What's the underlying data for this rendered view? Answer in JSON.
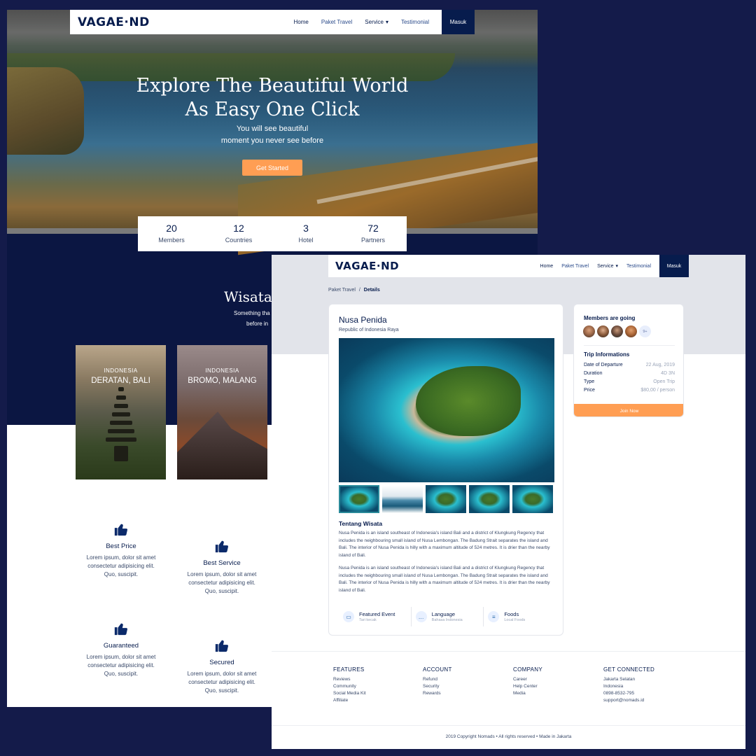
{
  "landing": {
    "logo": "VAGAE·ND",
    "nav": {
      "home": "Home",
      "paket": "Paket Travel",
      "service": "Service",
      "testimonial": "Testimonial",
      "masuk": "Masuk"
    },
    "hero": {
      "title_line1": "Explore The Beautiful World",
      "title_line2": "As Easy One Click",
      "sub_line1": "You will see beautiful",
      "sub_line2": "moment you never see before",
      "cta": "Get Started"
    },
    "stats": [
      {
        "num": "20",
        "label": "Members"
      },
      {
        "num": "12",
        "label": "Countries"
      },
      {
        "num": "3",
        "label": "Hotel"
      },
      {
        "num": "72",
        "label": "Partners"
      }
    ],
    "wisata": {
      "title": "Wisata",
      "sub_line1": "Something tha",
      "sub_line2": "before in"
    },
    "destinations": [
      {
        "country": "INDONESIA",
        "place": "DERATAN, BALI"
      },
      {
        "country": "INDONESIA",
        "place": "BROMO, MALANG"
      }
    ],
    "features": [
      {
        "name": "Best Price",
        "desc1": "Lorem ipsum, dolor sit amet",
        "desc2": "consectetur adipisicing elit.",
        "desc3": "Quo, suscipit."
      },
      {
        "name": "Best Service",
        "desc1": "Lorem ipsum, dolor sit amet",
        "desc2": "consectetur adipisicing elit.",
        "desc3": "Quo, suscipit."
      },
      {
        "name": "Guaranteed",
        "desc1": "Lorem ipsum, dolor sit amet",
        "desc2": "consectetur adipisicing elit.",
        "desc3": "Quo, suscipit."
      },
      {
        "name": "Secured",
        "desc1": "Lorem ipsum, dolor sit amet",
        "desc2": "consectetur adipisicing elit.",
        "desc3": "Quo, suscipit."
      }
    ]
  },
  "details": {
    "logo": "VAGAE·ND",
    "nav": {
      "home": "Home",
      "paket": "Paket Travel",
      "service": "Service",
      "testimonial": "Testimonial",
      "masuk": "Masuk"
    },
    "breadcrumb": {
      "parent": "Paket Travel",
      "sep": "/",
      "current": "Details"
    },
    "title": "Nusa Penida",
    "subtitle": "Republic of Indonesia Raya",
    "about_title": "Tentang Wisata",
    "about_p1": "Nusa Penida is an island southeast of Indonesia's island Bali and a district of Klungkung Regency that includes the neighbouring small island of Nusa Lembongan. The Badung Strait separates the island and Bali. The interior of Nusa Penida is hilly with a maximum altitude of 524 metres. It is drier than the nearby island of Bali.",
    "about_p2": "Nusa Penida is an island southeast of Indonesia's island Bali and a district of Klungkung Regency that includes the neighbouring small island of Nusa Lembongan. The Badung Strait separates the island and Bali. The interior of Nusa Penida is hilly with a maximum altitude of 524 metres. It is drier than the nearby island of Bali.",
    "features": [
      {
        "title": "Featured Event",
        "sub": "Tari kecak",
        "icon": "ticket-icon"
      },
      {
        "title": "Language",
        "sub": "Bahasa Indonesia",
        "icon": "chat-icon"
      },
      {
        "title": "Foods",
        "sub": "Local Foods",
        "icon": "burger-icon"
      }
    ],
    "side": {
      "members_title": "Members are going",
      "more": "9+",
      "trip_title": "Trip Informations",
      "rows": [
        {
          "k": "Date of Departure",
          "v": "22 Aug, 2019"
        },
        {
          "k": "Duration",
          "v": "4D 3N"
        },
        {
          "k": "Type",
          "v": "Open Trip"
        },
        {
          "k": "Price",
          "v": "$80,00 / person"
        }
      ],
      "join": "Join Now"
    },
    "footer": {
      "cols": [
        {
          "head": "FEATURES",
          "items": [
            "Reviews",
            "Community",
            "Social Media Kit",
            "Affiliate"
          ]
        },
        {
          "head": "ACCOUNT",
          "items": [
            "Refund",
            "Security",
            "Rewards"
          ]
        },
        {
          "head": "COMPANY",
          "items": [
            "Career",
            "Help Center",
            "Media"
          ]
        },
        {
          "head": "GET CONNECTED",
          "items": [
            "Jakarta Selatan",
            "Indonesia",
            "0898-8532-795",
            "support@nomads.id"
          ]
        }
      ],
      "copyright": "2019 Copyright Nomads • All rights reserved • Made in Jakarta"
    }
  },
  "colors": {
    "navy": "#071c4d",
    "orange": "#ff9e53",
    "bg": "#141b4a"
  }
}
